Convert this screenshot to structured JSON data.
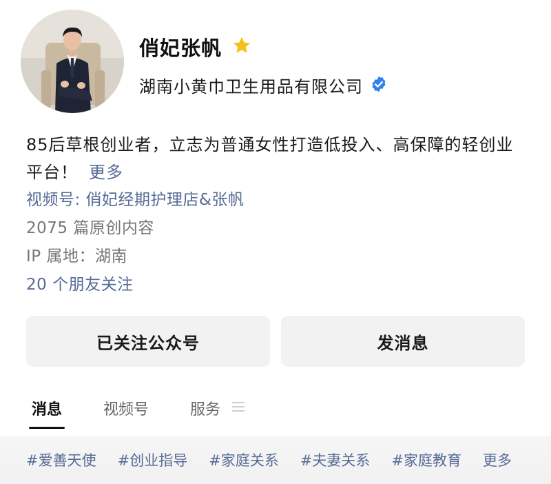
{
  "profile": {
    "name": "俏妃张帆",
    "company": "湖南小黄巾卫生用品有限公司",
    "star_icon": "star-icon",
    "verified_icon": "verified-badge-icon",
    "colors": {
      "star": "#f7c018",
      "verified": "#2f80ed",
      "link": "#576b95"
    }
  },
  "bio": {
    "text": "85后草根创业者，立志为普通女性打造低投入、高保障的轻创业平台！",
    "more_label": "更多"
  },
  "info": {
    "channel": "视频号: 俏妃经期护理店&张帆",
    "articles": "2075 篇原创内容",
    "ip": "IP 属地：湖南",
    "friends": "20 个朋友关注"
  },
  "buttons": {
    "follow_label": "已关注公众号",
    "message_label": "发消息"
  },
  "tabs": [
    {
      "label": "消息"
    },
    {
      "label": "视频号"
    },
    {
      "label": "服务"
    }
  ],
  "tags": [
    "#爱善天使",
    "#创业指导",
    "#家庭关系",
    "#夫妻关系",
    "#家庭教育"
  ],
  "tags_more_label": "更多"
}
